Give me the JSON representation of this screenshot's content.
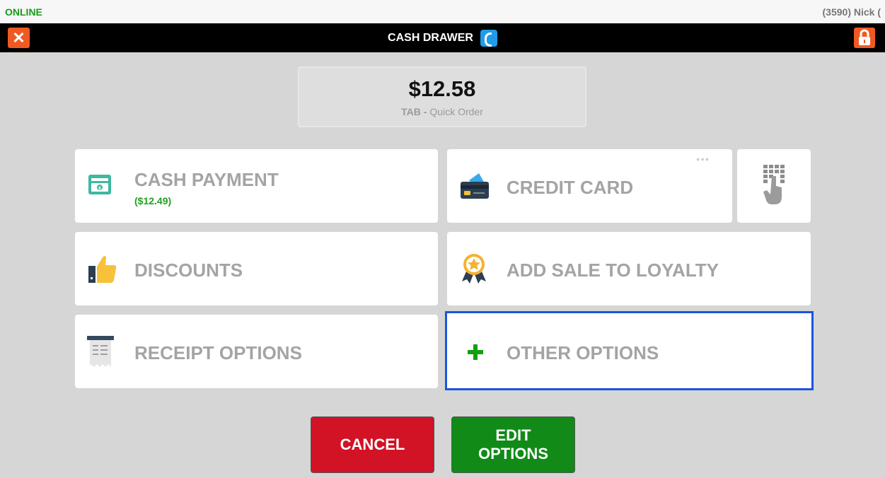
{
  "status": {
    "connection": "ONLINE",
    "user": "(3590) Nick ("
  },
  "titlebar": {
    "title": "CASH DRAWER",
    "close_icon": "close-icon",
    "lock_icon": "lock-icon"
  },
  "total": {
    "amount": "$12.58",
    "tab_label": "TAB -",
    "order_name": "Quick Order"
  },
  "tiles": {
    "cash": {
      "label": "CASH PAYMENT",
      "sublabel": "($12.49)",
      "icon": "cash-icon"
    },
    "credit": {
      "label": "CREDIT CARD",
      "icon": "credit-card-icon",
      "dots": "●●●"
    },
    "keypad": {
      "icon": "keypad-hand-icon"
    },
    "discounts": {
      "label": "DISCOUNTS",
      "icon": "thumbs-up-icon"
    },
    "loyalty": {
      "label": "ADD SALE TO LOYALTY",
      "icon": "loyalty-badge-icon"
    },
    "receipt": {
      "label": "RECEIPT OPTIONS",
      "icon": "receipt-icon"
    },
    "other": {
      "label": "OTHER OPTIONS",
      "icon": "plus-icon"
    }
  },
  "actions": {
    "cancel": "CANCEL",
    "edit_line1": "EDIT",
    "edit_line2": "OPTIONS"
  },
  "colors": {
    "accent_orange": "#f05a22",
    "online_green": "#1b9b1b",
    "cancel_red": "#d21225",
    "edit_green": "#118a18",
    "selected_blue": "#1a55dd"
  }
}
